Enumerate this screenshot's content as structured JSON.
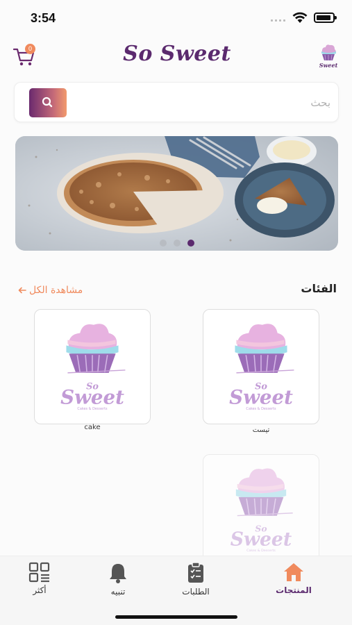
{
  "status_bar": {
    "time": "3:54"
  },
  "header": {
    "brand": "So Sweet",
    "cart_count": "0"
  },
  "search": {
    "placeholder": "بحث"
  },
  "banner": {
    "dots": 3,
    "active_dot": 3
  },
  "categories": {
    "title": "الفئات",
    "see_all": "مشاهدة الكل",
    "items": [
      {
        "label": "تيست"
      },
      {
        "label": "cake"
      },
      {
        "label": ""
      }
    ]
  },
  "logo": {
    "word1": "So",
    "word2": "Sweet",
    "tagline": "Cakes & Desserts"
  },
  "tabs": [
    {
      "label": "المنتجات",
      "icon": "home-icon",
      "active": true
    },
    {
      "label": "الطلبات",
      "icon": "clipboard-icon",
      "active": false
    },
    {
      "label": "تنبيه",
      "icon": "bell-icon",
      "active": false
    },
    {
      "label": "أكثر",
      "icon": "more-grid-icon",
      "active": false
    }
  ],
  "colors": {
    "brand": "#5b2a6e",
    "accent": "#f08a5d"
  }
}
